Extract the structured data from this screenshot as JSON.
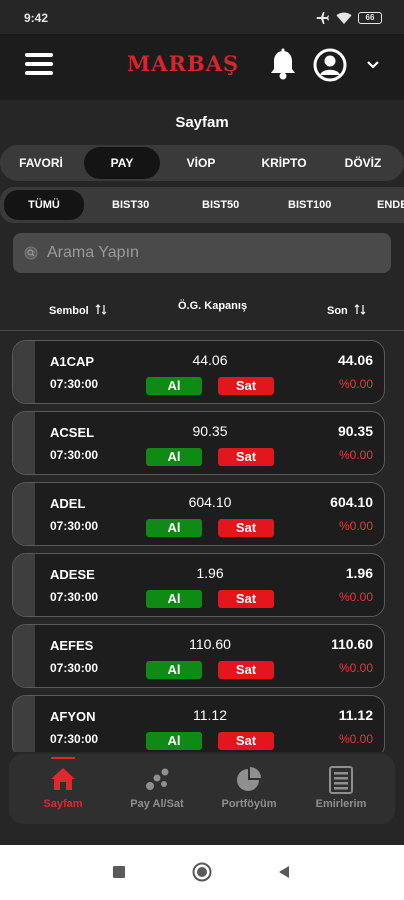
{
  "status_bar": {
    "time": "9:42",
    "battery": "66"
  },
  "header": {
    "logo": "MARBAŞ"
  },
  "page": {
    "title": "Sayfam"
  },
  "market_tabs": [
    {
      "label": "FAVORİ",
      "active": false
    },
    {
      "label": "PAY",
      "active": true
    },
    {
      "label": "VİOP",
      "active": false
    },
    {
      "label": "KRİPTO",
      "active": false
    },
    {
      "label": "DÖVİZ",
      "active": false
    }
  ],
  "index_tabs": [
    {
      "label": "TÜMÜ",
      "active": true
    },
    {
      "label": "BIST30",
      "active": false
    },
    {
      "label": "BIST50",
      "active": false
    },
    {
      "label": "BIST100",
      "active": false
    },
    {
      "label": "ENDE",
      "active": false
    }
  ],
  "search": {
    "placeholder": "Arama Yapın"
  },
  "columns": {
    "symbol": "Sembol",
    "prev_close": "Ö.G. Kapanış",
    "last": "Son"
  },
  "buttons": {
    "buy": "Al",
    "sell": "Sat"
  },
  "rows": [
    {
      "symbol": "A1CAP",
      "time": "07:30:00",
      "prev_close": "44.06",
      "last": "44.06",
      "change": "%0.00"
    },
    {
      "symbol": "ACSEL",
      "time": "07:30:00",
      "prev_close": "90.35",
      "last": "90.35",
      "change": "%0.00"
    },
    {
      "symbol": "ADEL",
      "time": "07:30:00",
      "prev_close": "604.10",
      "last": "604.10",
      "change": "%0.00"
    },
    {
      "symbol": "ADESE",
      "time": "07:30:00",
      "prev_close": "1.96",
      "last": "1.96",
      "change": "%0.00"
    },
    {
      "symbol": "AEFES",
      "time": "07:30:00",
      "prev_close": "110.60",
      "last": "110.60",
      "change": "%0.00"
    },
    {
      "symbol": "AFYON",
      "time": "07:30:00",
      "prev_close": "11.12",
      "last": "11.12",
      "change": "%0.00"
    }
  ],
  "bottom_nav": [
    {
      "label": "Sayfam",
      "icon": "home-icon",
      "active": true
    },
    {
      "label": "Pay Al/Sat",
      "icon": "trade-icon",
      "active": false
    },
    {
      "label": "Portföyüm",
      "icon": "pie-chart-icon",
      "active": false
    },
    {
      "label": "Emirlerim",
      "icon": "orders-icon",
      "active": false
    }
  ],
  "colors": {
    "accent": "#d7262b",
    "buy": "#0e8a15",
    "sell": "#e3161e",
    "change": "#e03a3a"
  }
}
